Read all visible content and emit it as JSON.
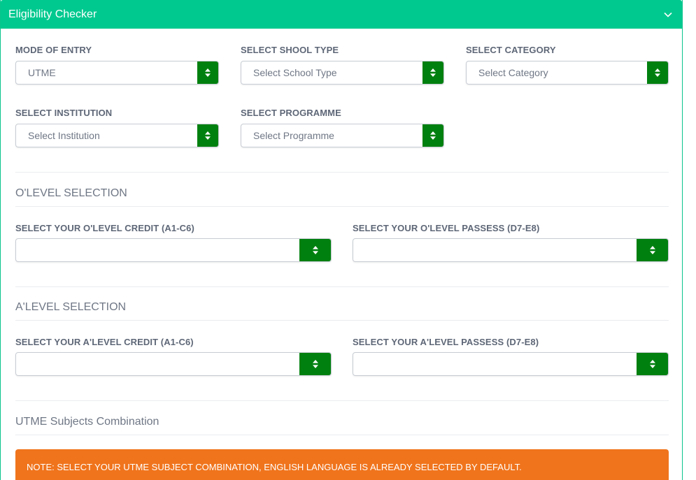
{
  "panel": {
    "title": "Eligibility Checker",
    "toggle_icon": "chevron-down-icon"
  },
  "colors": {
    "header": "#00c98f",
    "select_arrow": "#00800f",
    "note": "#f0741c"
  },
  "filters": {
    "mode_of_entry": {
      "label": "MODE OF ENTRY",
      "value": "UTME"
    },
    "school_type": {
      "label": "SELECT SHOOL TYPE",
      "value": "Select School Type"
    },
    "category": {
      "label": "SELECT CATEGORY",
      "value": "Select Category"
    },
    "institution": {
      "label": "SELECT INSTITUTION",
      "value": "Select Institution"
    },
    "programme": {
      "label": "SELECT PROGRAMME",
      "value": "Select Programme"
    }
  },
  "olevel": {
    "title": "O'LEVEL SELECTION",
    "credit": {
      "label": "SELECT YOUR O'LEVEL CREDIT (A1-C6)",
      "value": ""
    },
    "passes": {
      "label": "SELECT YOUR O'LEVEL PASSESS (D7-E8)",
      "value": ""
    }
  },
  "alevel": {
    "title": "A'LEVEL SELECTION",
    "credit": {
      "label": "SELECT YOUR A'LEVEL CREDIT (A1-C6)",
      "value": ""
    },
    "passes": {
      "label": "SELECT YOUR A'LEVEL PASSESS (D7-E8)",
      "value": ""
    }
  },
  "utme": {
    "title": "UTME Subjects Combination",
    "note": "NOTE: SELECT YOUR UTME SUBJECT COMBINATION, ENGLISH LANGUAGE IS ALREADY SELECTED BY DEFAULT."
  }
}
